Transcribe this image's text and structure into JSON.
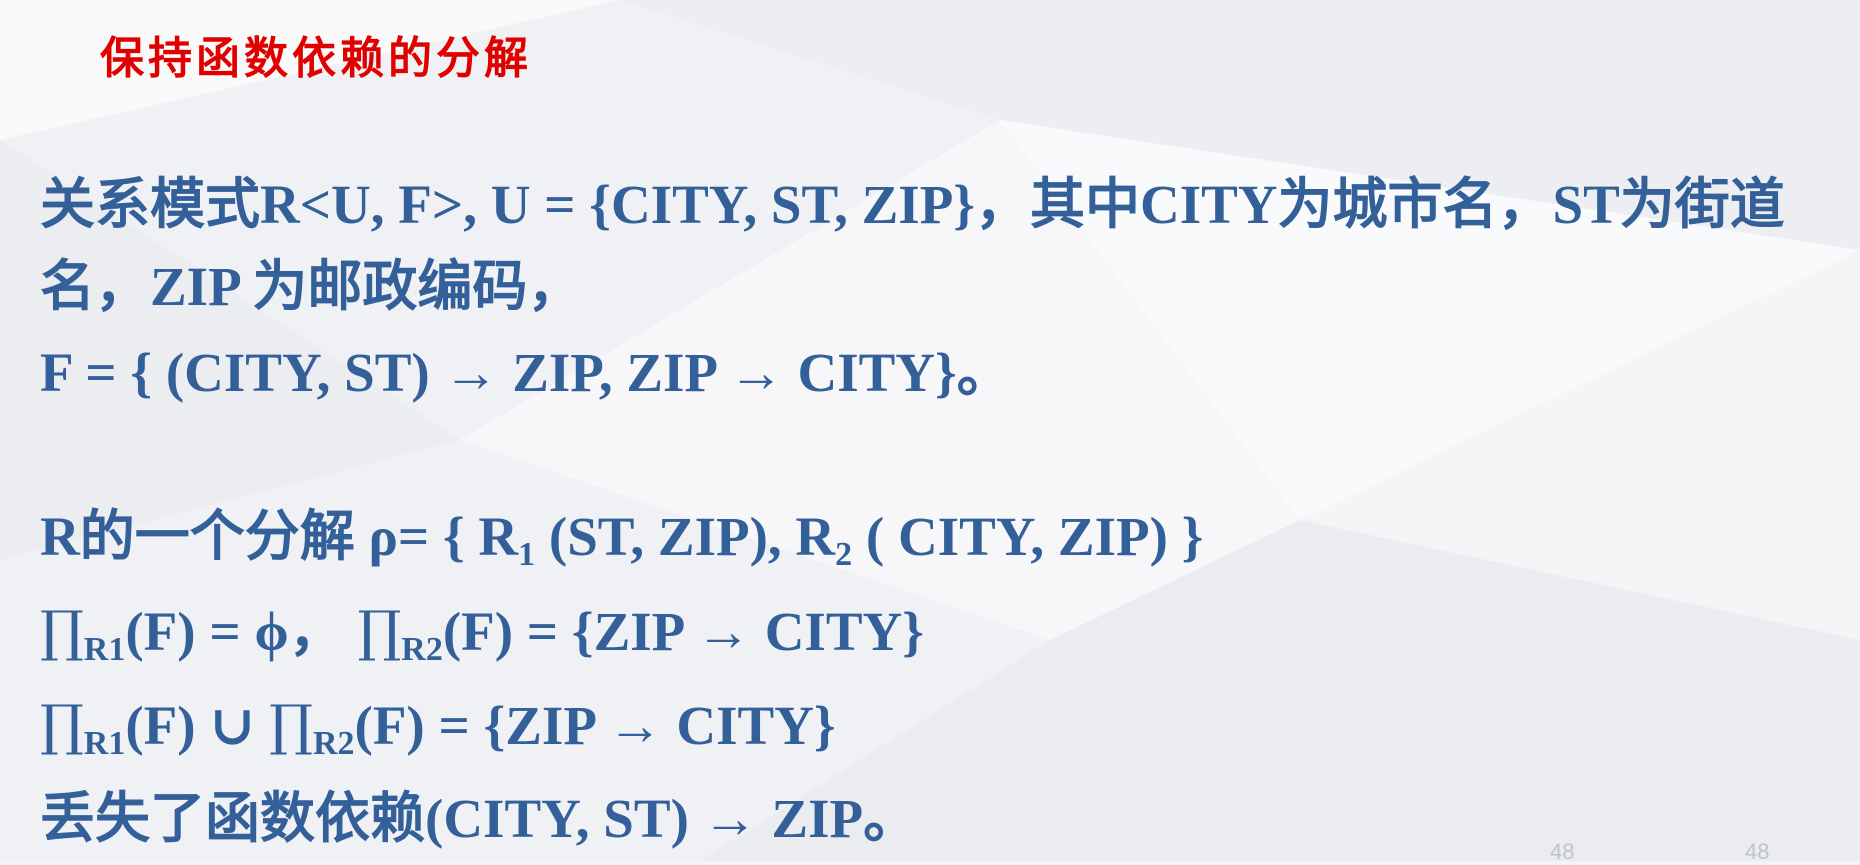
{
  "title": "保持函数依赖的分解",
  "lines": {
    "line1": "关系模式R<U, F>, U = {CITY, ST, ZIP}，其中CITY为城市名，ST为街道",
    "line2": "名，ZIP 为邮政编码，",
    "line3": "F = { (CITY, ST) → ZIP,  ZIP → CITY}。",
    "line4": {
      "p1": "R的一个分解 ρ= { R",
      "sub1": "1",
      "p2": " (ST, ZIP), R",
      "sub2": "2",
      "p3": " ( CITY, ZIP) }"
    },
    "line5": {
      "pi1": "∏",
      "sub1": "R1",
      "p1": "(F) = ϕ，  ",
      "pi2": "∏",
      "sub2": "R2",
      "p2": "(F) = {ZIP → CITY}"
    },
    "line6": {
      "pi1": "∏",
      "sub1": "R1",
      "p1": "(F)  ∪  ",
      "pi2": "∏",
      "sub2": "R2",
      "p2": "(F) = {ZIP → CITY}"
    },
    "line7": "丢失了函数依赖(CITY, ST) → ZIP。"
  },
  "page_numbers": [
    "48",
    "48"
  ],
  "colors": {
    "title": "#e00000",
    "body_text": "#34609a",
    "background": "#f3f4f7"
  }
}
